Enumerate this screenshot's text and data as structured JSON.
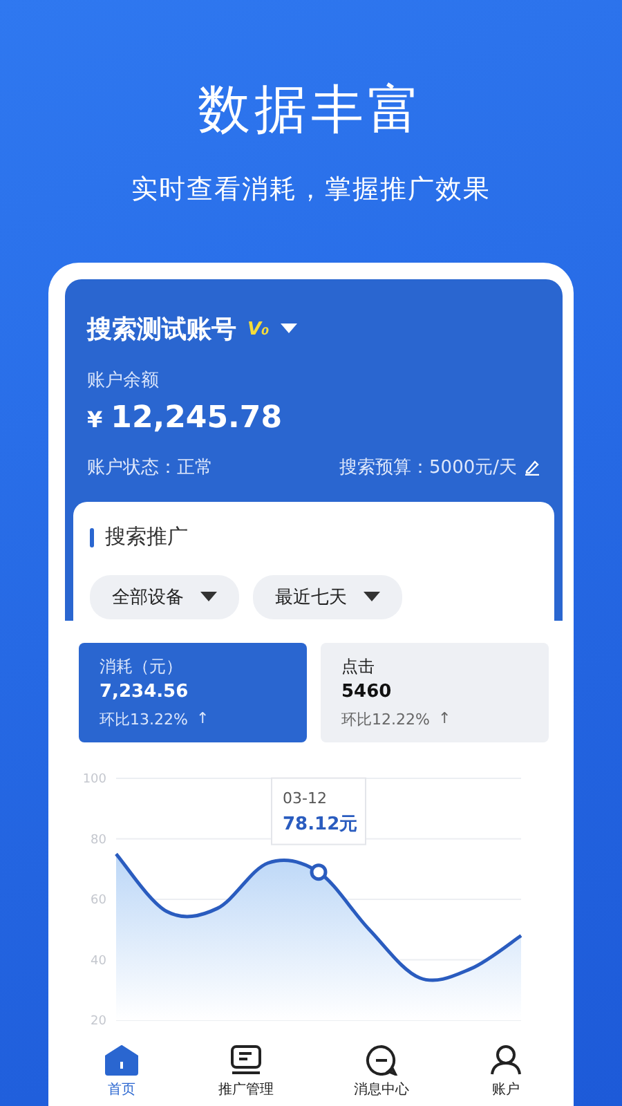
{
  "banner": {
    "title": "数据丰富",
    "subtitle": "实时查看消耗，掌握推广效果"
  },
  "account": {
    "name": "搜索测试账号",
    "badge": "V₀",
    "balance_label": "账户余额",
    "currency": "¥",
    "balance": "12,245.78",
    "status": "账户状态：正常",
    "budget": "搜索预算：5000元/天"
  },
  "section": {
    "title": "搜索推广",
    "filters": [
      "全部设备",
      "最近七天"
    ]
  },
  "metrics": [
    {
      "label": "消耗（元）",
      "value": "7,234.56",
      "change": "环比13.22%",
      "arrow": "↑",
      "selected": true
    },
    {
      "label": "点击",
      "value": "5460",
      "change": "环比12.22%",
      "arrow": "↑",
      "selected": false
    }
  ],
  "chart_data": {
    "type": "area",
    "ylim": [
      20,
      100
    ],
    "yticks": [
      20,
      40,
      60,
      80,
      100
    ],
    "grid": true,
    "series": [
      {
        "color": "#2a5cbf",
        "values": [
          75,
          56,
          57,
          72,
          69,
          50,
          34,
          37,
          48
        ]
      }
    ],
    "annotations": [
      "03-12",
      "78.12元"
    ]
  },
  "tab_bar": [
    {
      "label": "首页",
      "kind": "home",
      "selected": true
    },
    {
      "label": "推广管理",
      "kind": "board",
      "selected": false
    },
    {
      "label": "消息中心",
      "kind": "chat",
      "selected": false
    },
    {
      "label": "账户",
      "kind": "person",
      "selected": false
    }
  ]
}
